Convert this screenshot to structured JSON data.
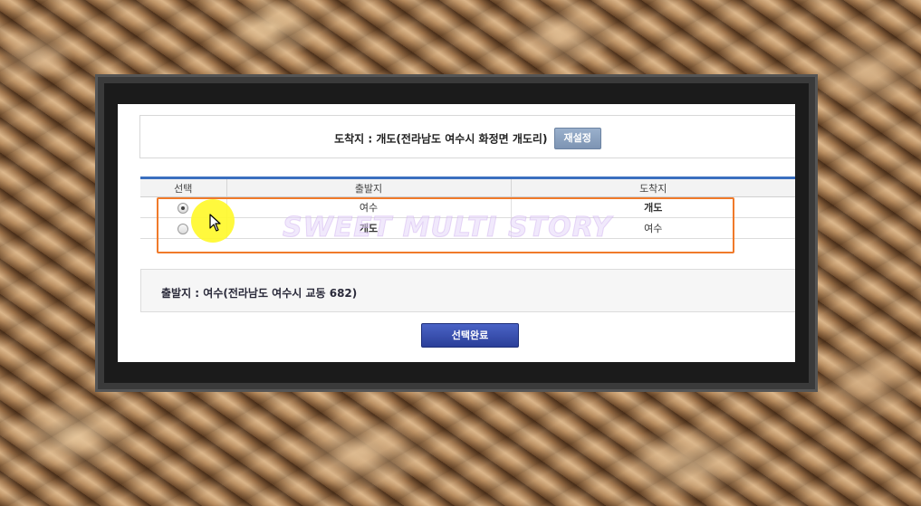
{
  "destination": {
    "text": "도착지 : 개도(전라남도 여수시 화정면 개도리)",
    "reset_label": "재설정"
  },
  "route_table": {
    "headers": [
      "선택",
      "출발지",
      "도착지"
    ],
    "rows": [
      {
        "selected": true,
        "origin": "여수",
        "destination": "개도"
      },
      {
        "selected": false,
        "origin": "개도",
        "destination": "여수"
      }
    ]
  },
  "origin_summary": "출발지 : 여수(전라남도 여수시 교동 682)",
  "confirm_label": "선택완료",
  "watermark": "SWEET MULTI STORY",
  "colors": {
    "header_border": "#3a6fbf",
    "highlight": "#f07a2a",
    "confirm_button": "#2b3f99",
    "reset_button": "#7d94b3",
    "cursor_halo": "#fff828"
  }
}
